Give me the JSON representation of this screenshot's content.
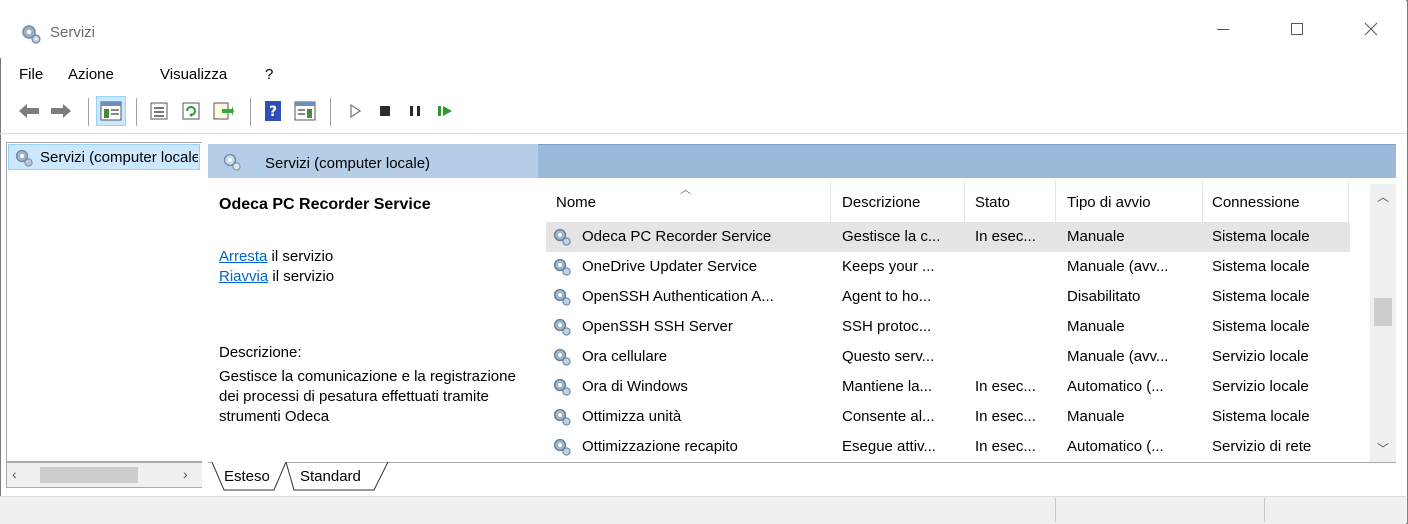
{
  "window": {
    "title": "Servizi",
    "icon": "gear-icon"
  },
  "menu": {
    "items": [
      "File",
      "Azione",
      "Visualizza",
      "?"
    ]
  },
  "toolbar": {
    "buttons": [
      "back-arrow-icon",
      "forward-arrow-icon",
      "console-tree-icon",
      "properties-icon",
      "refresh-icon",
      "export-list-icon",
      "help-icon",
      "show-hide-icon",
      "start-icon",
      "stop-icon",
      "pause-icon",
      "resume-icon"
    ]
  },
  "tree": {
    "root_label": "Servizi (computer locale)"
  },
  "pane_header": {
    "label": "Servizi (computer locale)"
  },
  "extended": {
    "service_name": "Odeca PC Recorder Service",
    "stop_link": "Arresta",
    "stop_suffix": " il servizio",
    "restart_link": "Riavvia",
    "restart_suffix": " il servizio",
    "description_label": "Descrizione:",
    "description_text": "Gestisce la comunicazione e la registrazione dei processi di pesatura effettuati tramite strumenti Odeca"
  },
  "columns": [
    "Nome",
    "Descrizione",
    "Stato",
    "Tipo di avvio",
    "Connessione"
  ],
  "rows": [
    {
      "name": "Odeca PC Recorder Service",
      "desc": "Gestisce la c...",
      "state": "In esec...",
      "startup": "Manuale",
      "logon": "Sistema locale",
      "selected": true
    },
    {
      "name": "OneDrive Updater Service",
      "desc": "Keeps your ...",
      "state": "",
      "startup": "Manuale (avv...",
      "logon": "Sistema locale"
    },
    {
      "name": "OpenSSH Authentication A...",
      "desc": "Agent to ho...",
      "state": "",
      "startup": "Disabilitato",
      "logon": "Sistema locale"
    },
    {
      "name": "OpenSSH SSH Server",
      "desc": "SSH protoc...",
      "state": "",
      "startup": "Manuale",
      "logon": "Sistema locale"
    },
    {
      "name": "Ora cellulare",
      "desc": "Questo serv...",
      "state": "",
      "startup": "Manuale (avv...",
      "logon": "Servizio locale"
    },
    {
      "name": "Ora di Windows",
      "desc": "Mantiene la...",
      "state": "In esec...",
      "startup": "Automatico (...",
      "logon": "Servizio locale"
    },
    {
      "name": "Ottimizza unità",
      "desc": "Consente al...",
      "state": "In esec...",
      "startup": "Manuale",
      "logon": "Sistema locale"
    },
    {
      "name": "Ottimizzazione recapito",
      "desc": "Esegue attiv...",
      "state": "In esec...",
      "startup": "Automatico (...",
      "logon": "Servizio di rete"
    }
  ],
  "tabs": [
    "Esteso",
    "Standard"
  ]
}
